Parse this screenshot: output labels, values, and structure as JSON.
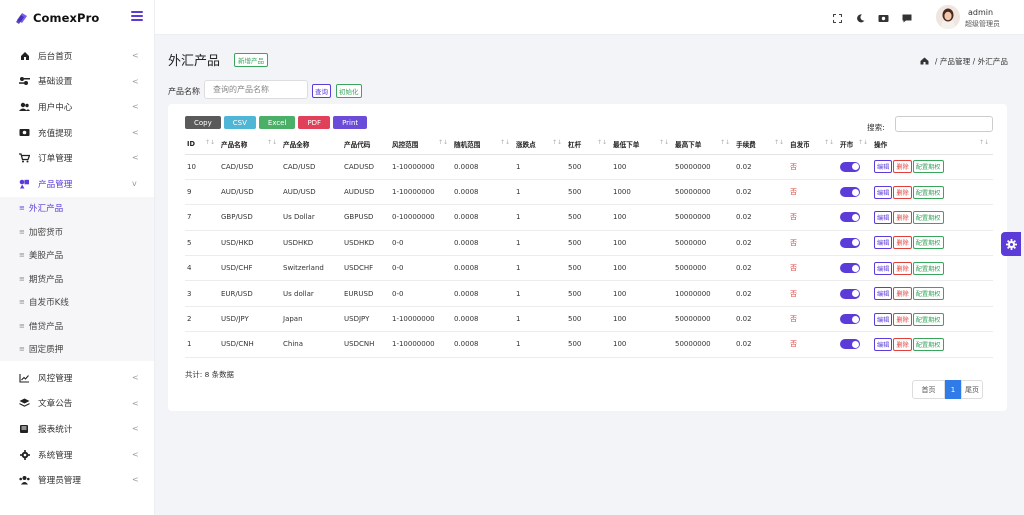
{
  "brand": {
    "name": "ComexPro"
  },
  "sidebar": {
    "items": [
      {
        "label": "后台首页",
        "icon": "home-icon",
        "arrow": "<"
      },
      {
        "label": "基础设置",
        "icon": "settings-sliders-icon",
        "arrow": "<"
      },
      {
        "label": "用户中心",
        "icon": "users-icon",
        "arrow": "<"
      },
      {
        "label": "充值提现",
        "icon": "money-icon",
        "arrow": "<"
      },
      {
        "label": "订单管理",
        "icon": "cart-icon",
        "arrow": "<"
      },
      {
        "label": "产品管理",
        "icon": "product-icon",
        "arrow": "v"
      }
    ],
    "submenu": [
      {
        "label": "外汇产品"
      },
      {
        "label": "加密货币"
      },
      {
        "label": "美股产品"
      },
      {
        "label": "期货产品"
      },
      {
        "label": "自发币K线"
      },
      {
        "label": "借贷产品"
      },
      {
        "label": "固定质押"
      }
    ],
    "items_after": [
      {
        "label": "风控管理",
        "icon": "chart-line-icon",
        "arrow": "<"
      },
      {
        "label": "文章公告",
        "icon": "layers-icon",
        "arrow": "<"
      },
      {
        "label": "报表统计",
        "icon": "report-icon",
        "arrow": "<"
      },
      {
        "label": "系统管理",
        "icon": "gear-icon",
        "arrow": "<"
      },
      {
        "label": "管理员管理",
        "icon": "admin-users-icon",
        "arrow": "<"
      }
    ]
  },
  "topbar": {
    "user_name": "admin",
    "user_role": "超级管理员"
  },
  "page": {
    "title": "外汇产品",
    "add_button": "新增产品",
    "breadcrumb": [
      "产品管理",
      "外汇产品"
    ],
    "breadcrumb_sep": "/"
  },
  "search": {
    "label": "产品名称",
    "placeholder": "查询的产品名称",
    "query_button": "查询",
    "reset_button": "初始化"
  },
  "export_buttons": [
    {
      "label": "Copy",
      "color": "#5a5a5a"
    },
    {
      "label": "CSV",
      "color": "#4fb6d6"
    },
    {
      "label": "Excel",
      "color": "#4caf68"
    },
    {
      "label": "PDF",
      "color": "#e0405a"
    },
    {
      "label": "Print",
      "color": "#6a4cd8"
    }
  ],
  "table": {
    "search_label": "搜索:",
    "columns": [
      "ID",
      "产品名称",
      "产品全称",
      "产品代码",
      "风控范围",
      "随机范围",
      "涨跌点",
      "杠杆",
      "最低下单",
      "最高下单",
      "手续费",
      "自发币",
      "开市",
      "操作"
    ],
    "rows": [
      {
        "id": "10",
        "name": "CAD/USD",
        "full": "CAD/USD",
        "code": "CADUSD",
        "risk": "1-10000000",
        "rand": "0.0008",
        "pts": "1",
        "lev": "500",
        "min": "100",
        "max": "50000000",
        "fee": "0.02",
        "self": "否"
      },
      {
        "id": "9",
        "name": "AUD/USD",
        "full": "AUD/USD",
        "code": "AUDUSD",
        "risk": "1-10000000",
        "rand": "0.0008",
        "pts": "1",
        "lev": "500",
        "min": "1000",
        "max": "50000000",
        "fee": "0.02",
        "self": "否"
      },
      {
        "id": "7",
        "name": "GBP/USD",
        "full": "Us Dollar",
        "code": "GBPUSD",
        "risk": "0-10000000",
        "rand": "0.0008",
        "pts": "1",
        "lev": "500",
        "min": "100",
        "max": "50000000",
        "fee": "0.02",
        "self": "否"
      },
      {
        "id": "5",
        "name": "USD/HKD",
        "full": "USDHKD",
        "code": "USDHKD",
        "risk": "0-0",
        "rand": "0.0008",
        "pts": "1",
        "lev": "500",
        "min": "100",
        "max": "5000000",
        "fee": "0.02",
        "self": "否"
      },
      {
        "id": "4",
        "name": "USD/CHF",
        "full": "Switzerland",
        "code": "USDCHF",
        "risk": "0-0",
        "rand": "0.0008",
        "pts": "1",
        "lev": "500",
        "min": "100",
        "max": "5000000",
        "fee": "0.02",
        "self": "否"
      },
      {
        "id": "3",
        "name": "EUR/USD",
        "full": "Us dollar",
        "code": "EURUSD",
        "risk": "0-0",
        "rand": "0.0008",
        "pts": "1",
        "lev": "500",
        "min": "100",
        "max": "10000000",
        "fee": "0.02",
        "self": "否"
      },
      {
        "id": "2",
        "name": "USD/JPY",
        "full": "Japan",
        "code": "USDJPY",
        "risk": "1-10000000",
        "rand": "0.0008",
        "pts": "1",
        "lev": "500",
        "min": "100",
        "max": "50000000",
        "fee": "0.02",
        "self": "否"
      },
      {
        "id": "1",
        "name": "USD/CNH",
        "full": "China",
        "code": "USDCNH",
        "risk": "1-10000000",
        "rand": "0.0008",
        "pts": "1",
        "lev": "500",
        "min": "100",
        "max": "50000000",
        "fee": "0.02",
        "self": "否"
      }
    ],
    "actions": {
      "edit": "编辑",
      "delete": "删除",
      "config": "配置期权"
    },
    "total": "共计: 8 条数据"
  },
  "pagination": {
    "first": "首页",
    "current": "1",
    "last": "尾页"
  },
  "colors": {
    "accent": "#5b3cd8",
    "green": "#3aa55d",
    "red": "#e0403a",
    "blue": "#2f7be8"
  }
}
